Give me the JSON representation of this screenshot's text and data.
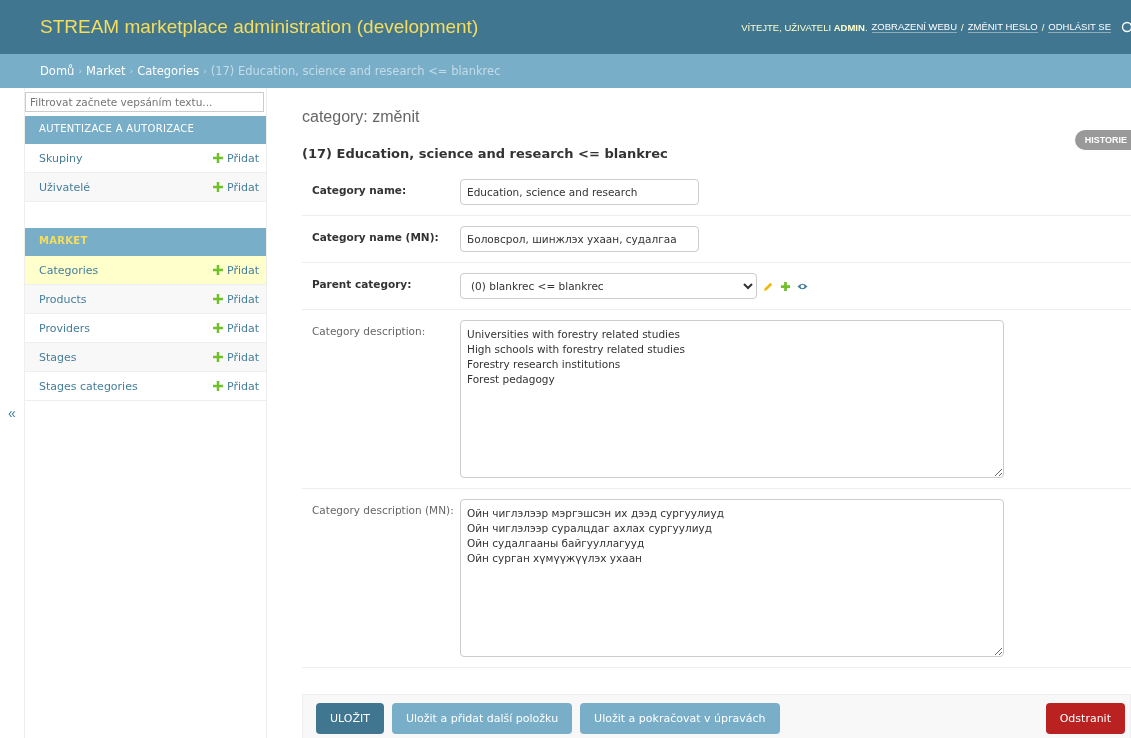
{
  "header": {
    "title": "STREAM marketplace administration (development)",
    "welcome": "VÍTEJTE, UŽIVATELI",
    "user": "ADMIN",
    "period": ".",
    "links": [
      "ZOBRAZENÍ WEBU",
      "ZMĚNIT HESLO",
      "ODHLÁSIT SE"
    ],
    "separator": "/"
  },
  "breadcrumb_separator": "›",
  "breadcrumbs": [
    {
      "label": "Domů",
      "link": true
    },
    {
      "label": "Market",
      "link": true
    },
    {
      "label": "Categories",
      "link": true
    },
    {
      "label": "(17) Education, science and research <= blankrec",
      "link": false
    }
  ],
  "sidebar": {
    "filter": {
      "placeholder": "Filtrovat začnete vepsáním textu..."
    },
    "toggle": "«",
    "modules": [
      {
        "title": "AUTENTIZACE A AUTORIZACE",
        "selected": false,
        "items": [
          {
            "name": "Skupiny",
            "add": "Přidat",
            "selected": false
          },
          {
            "name": "Uživatelé",
            "add": "Přidat",
            "selected": false
          }
        ]
      },
      {
        "title": "MARKET",
        "selected": true,
        "items": [
          {
            "name": "Categories",
            "add": "Přidat",
            "selected": true
          },
          {
            "name": "Products",
            "add": "Přidat",
            "selected": false
          },
          {
            "name": "Providers",
            "add": "Přidat",
            "selected": false
          },
          {
            "name": "Stages",
            "add": "Přidat",
            "selected": false
          },
          {
            "name": "Stages categories",
            "add": "Přidat",
            "selected": false
          }
        ]
      }
    ]
  },
  "page": {
    "title": "category: změnit",
    "subtitle": "(17) Education, science and research <= blankrec",
    "history": "HISTORIE"
  },
  "fields": [
    {
      "kind": "text",
      "label": "Category name:",
      "required": true,
      "value": "Education, science and research"
    },
    {
      "kind": "text",
      "label": "Category name (MN):",
      "required": true,
      "value": "Боловсрол, шинжлэх ухаан, судалгаа"
    },
    {
      "kind": "select",
      "label": "Parent category:",
      "required": true,
      "value": "(0) blankrec <= blankrec"
    },
    {
      "kind": "textarea",
      "label": "Category description:",
      "required": false,
      "value": "Universities with forestry related studies\nHigh schools with forestry related studies\nForestry research institutions\nForest pedagogy"
    },
    {
      "kind": "textarea",
      "label": "Category description (MN):",
      "required": false,
      "value": "Ойн чиглэлээр мэргэшсэн их дээд сургуулиуд\nОйн чиглэлээр суралцдаг ахлах сургуулиуд\nОйн судалгааны байгууллагууд\nОйн сурган хүмүүжүүлэх ухаан"
    }
  ],
  "buttons": [
    {
      "kind": "default",
      "label": "ULOŽIT"
    },
    {
      "kind": "secondary",
      "label": "Uložit a přidat další položku"
    },
    {
      "kind": "secondary",
      "label": "Uložit a pokračovat v úpravách"
    },
    {
      "kind": "delete",
      "label": "Odstranit"
    }
  ]
}
